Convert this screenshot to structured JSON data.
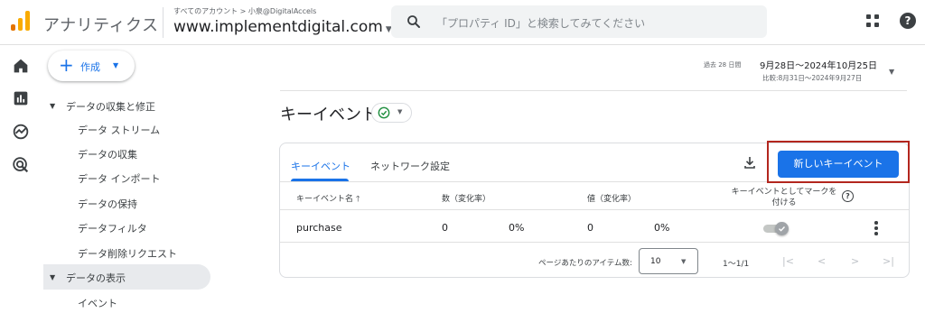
{
  "header": {
    "app_name": "アナリティクス",
    "account_breadcrumb": "すべてのアカウント > 小泉@DigitalAccels",
    "property_name": "www.implementdigital.com",
    "search_placeholder": "「プロパティ ID」と検索してみてください",
    "help_icon_glyph": "?"
  },
  "create_button": {
    "label": "作成"
  },
  "nav": {
    "section_collection": "データの収集と修正",
    "items": [
      "データ ストリーム",
      "データの収集",
      "データ インポート",
      "データの保持",
      "データフィルタ",
      "データ削除リクエスト"
    ],
    "section_display": "データの表示",
    "display_items": [
      "イベント"
    ]
  },
  "date_range": {
    "tag": "過去 28 日間",
    "main": "9月28日～2024年10月25日",
    "compare": "比較:8月31日～2024年9月27日"
  },
  "page": {
    "title": "キーイベント"
  },
  "tabs": [
    {
      "label": "キーイベント",
      "active": true
    },
    {
      "label": "ネットワーク設定",
      "active": false
    }
  ],
  "new_button": {
    "label": "新しいキーイベント"
  },
  "table": {
    "columns": {
      "name": "キーイベント名",
      "count": "数（変化率）",
      "value": "値（変化率）",
      "mark": "キーイベントとしてマークを付ける"
    },
    "rows": [
      {
        "name": "purchase",
        "count": "0",
        "count_change": "0%",
        "value": "0",
        "value_change": "0%",
        "marked": true
      }
    ]
  },
  "pagination": {
    "items_per_page_label": "ページあたりのアイテム数:",
    "items_per_page": "10",
    "range": "1～1/1"
  },
  "colors": {
    "brand_blue": "#1a73e8",
    "highlight_red": "#b3261e",
    "status_green": "#1e8e3e",
    "logo_orange": "#f9ab00",
    "logo_dark_orange": "#e37400"
  }
}
